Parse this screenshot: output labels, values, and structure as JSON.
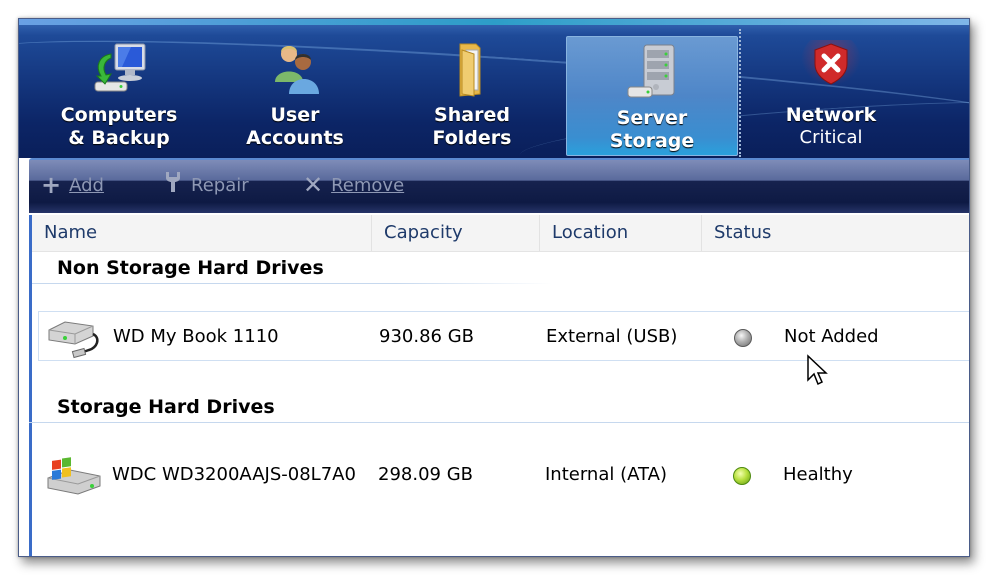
{
  "nav": {
    "tabs": [
      {
        "id": "computers",
        "label_line1": "Computers",
        "label_line2": "& Backup",
        "icon": "computer-backup-icon",
        "active": false
      },
      {
        "id": "users",
        "label_line1": "User",
        "label_line2": "Accounts",
        "icon": "users-icon",
        "active": false
      },
      {
        "id": "shared",
        "label_line1": "Shared",
        "label_line2": "Folders",
        "icon": "folder-icon",
        "active": false
      },
      {
        "id": "storage",
        "label_line1": "Server",
        "label_line2": "Storage",
        "icon": "server-icon",
        "active": true
      },
      {
        "id": "network",
        "label_line1": "Network",
        "status": "Critical",
        "icon": "shield-error-icon",
        "active": false
      }
    ]
  },
  "toolbar": {
    "add_label": "Add",
    "repair_label": "Repair",
    "remove_label": "Remove"
  },
  "table": {
    "columns": [
      "Name",
      "Capacity",
      "Location",
      "Status"
    ],
    "groups": [
      {
        "title": "Non Storage Hard Drives",
        "rows": [
          {
            "name": "WD My Book 1110",
            "capacity": "930.86 GB",
            "location": "External (USB)",
            "status": "Not Added",
            "status_color": "gray",
            "icon": "external-usb-drive-icon"
          }
        ]
      },
      {
        "title": "Storage Hard Drives",
        "rows": [
          {
            "name": "WDC WD3200AAJS-08L7A0",
            "capacity": "298.09 GB",
            "location": "Internal (ATA)",
            "status": "Healthy",
            "status_color": "green",
            "icon": "windows-internal-drive-icon"
          }
        ]
      }
    ]
  },
  "colors": {
    "nav_bg": "#14367e",
    "active_tab": "#4e86c8",
    "status_gray": "#9a9a9a",
    "status_green": "#9ccc2c",
    "critical_red": "#d02a2a"
  }
}
